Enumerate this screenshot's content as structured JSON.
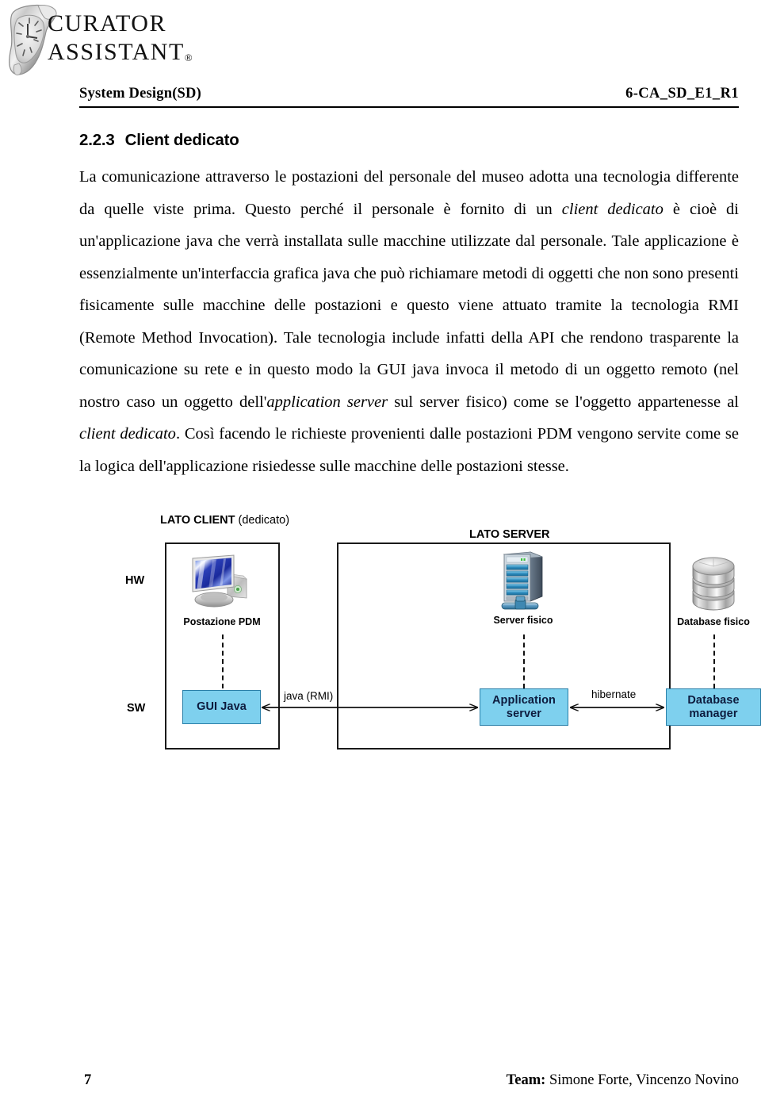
{
  "brand": {
    "line1": "CURATOR",
    "line2": "ASSISTANT",
    "registered_mark": "®",
    "logo_icon": "melting-clock-logo"
  },
  "header": {
    "doc_kind": "System Design(SD)",
    "doc_code": "6-CA_SD_E1_R1"
  },
  "section": {
    "number": "2.2.3",
    "title": "Client dedicato",
    "paragraph_runs": [
      {
        "text": "La comunicazione attraverso le postazioni del personale del museo adotta una tecnologia differente da quelle viste prima. Questo perché il personale è fornito di un ",
        "style": "normal"
      },
      {
        "text": "client dedicato",
        "style": "italic"
      },
      {
        "text": " è cioè di un'applicazione java che verrà installata sulle macchine utilizzate dal personale. Tale applicazione è essenzialmente un'interfaccia grafica java che può richiamare metodi di oggetti che non sono presenti fisicamente sulle macchine delle postazioni e questo viene attuato tramite la tecnologia RMI (Remote Method Invocation). Tale tecnologia include infatti della API che rendono trasparente la comunicazione su rete e in questo modo la GUI java invoca il metodo di un oggetto remoto (nel nostro caso un oggetto dell'",
        "style": "normal"
      },
      {
        "text": "application server",
        "style": "italic"
      },
      {
        "text": " sul server fisico) come se l'oggetto appartenesse al ",
        "style": "normal"
      },
      {
        "text": "client dedicato",
        "style": "italic"
      },
      {
        "text": ". Così facendo le richieste provenienti dalle postazioni PDM vengono servite come se la logica dell'applicazione risiedesse sulle macchine delle postazioni stesse.",
        "style": "normal"
      }
    ]
  },
  "diagram": {
    "zone_client_label_bold": "LATO CLIENT",
    "zone_client_label_normal": " (dedicato)",
    "zone_server_label": "LATO SERVER",
    "row_labels": {
      "hw": "HW",
      "sw": "SW"
    },
    "nodes": [
      {
        "caption": "Postazione PDM",
        "icon": "desktop-computer-icon"
      },
      {
        "caption": "Server fisico",
        "icon": "server-tower-icon"
      },
      {
        "caption": "Database fisico",
        "icon": "database-cylinder-icon"
      }
    ],
    "sw_boxes": [
      {
        "label": "GUI Java"
      },
      {
        "label": "Application\nserver",
        "line1": "Application",
        "line2": "server"
      },
      {
        "label": "Database\nmanager",
        "line1": "Database",
        "line2": "manager"
      }
    ],
    "links": [
      {
        "label": "java (RMI)",
        "kind": "bidirectional"
      },
      {
        "label": "hibernate",
        "kind": "bidirectional"
      }
    ],
    "colors": {
      "sw_box_fill": "#7ed0ee",
      "sw_box_border": "#2a7fa8",
      "sw_box_text": "#0d1b3e",
      "zone_border": "#1a1a1a"
    }
  },
  "footer": {
    "page_number": "7",
    "team_label": "Team:",
    "team_members": " Simone Forte, Vincenzo Novino"
  }
}
